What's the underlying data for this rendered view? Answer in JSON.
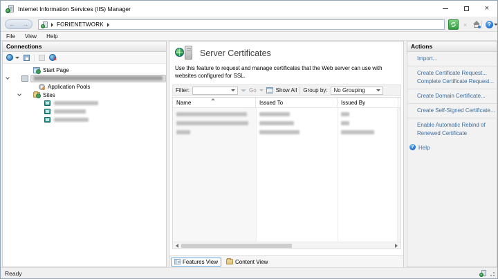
{
  "window": {
    "title": "Internet Information Services (IIS) Manager"
  },
  "address_bar": {
    "breadcrumb_root": "FORIENETWORK"
  },
  "menu_bar": {
    "items": [
      "File",
      "View",
      "Help"
    ]
  },
  "connections_panel": {
    "header": "Connections",
    "tree": {
      "start_page_label": "Start Page",
      "server_name_redacted": true,
      "application_pools_label": "Application Pools",
      "sites_label": "Sites",
      "redacted_site_count": 3
    }
  },
  "content_panel": {
    "title": "Server Certificates",
    "description": "Use this feature to request and manage certificates that the Web server can use with websites configured for SSL.",
    "filter_bar": {
      "filter_label": "Filter:",
      "go_label": "Go",
      "show_all_label": "Show All",
      "group_by_label": "Group by:",
      "group_by_value": "No Grouping"
    },
    "table": {
      "columns": [
        "Name",
        "Issued To",
        "Issued By"
      ],
      "sort_column": "Name",
      "sort_direction": "ascending",
      "redacted_row_count": 3
    },
    "view_tabs": [
      {
        "label": "Features View",
        "active": true
      },
      {
        "label": "Content View",
        "active": false
      }
    ]
  },
  "actions_panel": {
    "header": "Actions",
    "link_groups": [
      [
        "Import..."
      ],
      [
        "Create Certificate Request...",
        "Complete Certificate Request..."
      ],
      [
        "Create Domain Certificate..."
      ],
      [
        "Create Self-Signed Certificate..."
      ],
      [
        "Enable Automatic Rebind of Renewed Certificate"
      ]
    ],
    "help_label": "Help"
  },
  "status_bar": {
    "text": "Ready"
  },
  "colors": {
    "link_blue": "#3d6d9e",
    "refresh_green": "#2f9e3f",
    "active_tab_border": "#66a8e0"
  }
}
